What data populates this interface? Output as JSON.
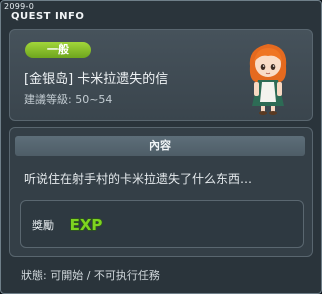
{
  "window": {
    "version": "2099-0",
    "title": "QUEST INFO"
  },
  "quest": {
    "category_badge": "一般",
    "name": "[金银岛] 卡米拉遗失的信",
    "recommended_level": "建議等級: 50~54",
    "npc_portrait": "red-haired-girl-npc"
  },
  "content": {
    "header": "內容",
    "description": "听说住在射手村的卡米拉遗失了什么东西…"
  },
  "reward": {
    "label": "獎勵",
    "icon": "exp-icon",
    "icon_text": "EXP"
  },
  "status": {
    "text": "狀態: 可開始 / 不可执行任務"
  },
  "colors": {
    "badge_green": "#8cc22a",
    "exp_green": "#7ed321",
    "window_bg": "#2a343b"
  }
}
